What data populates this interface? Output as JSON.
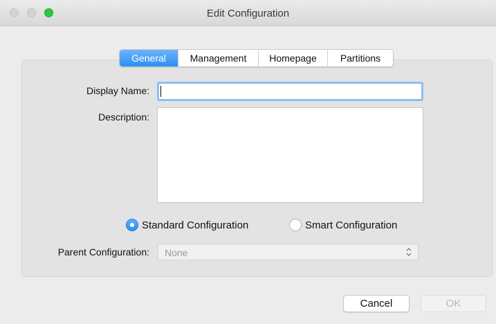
{
  "window": {
    "title": "Edit Configuration",
    "accent_color": "#2b8ff5"
  },
  "tabs": [
    {
      "label": "General",
      "selected": true
    },
    {
      "label": "Management",
      "selected": false
    },
    {
      "label": "Homepage",
      "selected": false
    },
    {
      "label": "Partitions",
      "selected": false
    }
  ],
  "form": {
    "display_name_label": "Display Name:",
    "display_name_value": "",
    "description_label": "Description:",
    "description_value": "",
    "radio_standard_label": "Standard Configuration",
    "radio_standard_selected": true,
    "radio_smart_label": "Smart Configuration",
    "radio_smart_selected": false,
    "parent_label": "Parent Configuration:",
    "parent_value": "None"
  },
  "buttons": {
    "cancel_label": "Cancel",
    "ok_label": "OK",
    "ok_enabled": false
  },
  "icons": {
    "select_chevron": "chevron-up-down-icon"
  }
}
